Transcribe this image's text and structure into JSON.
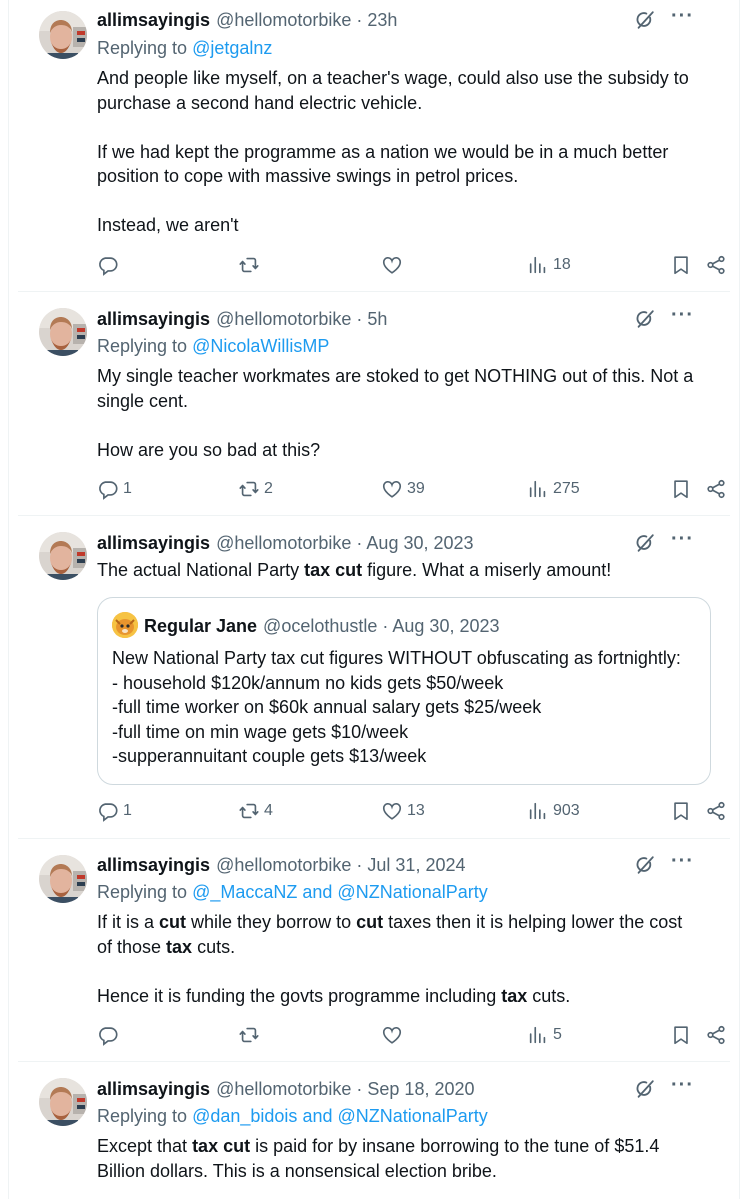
{
  "tweets": [
    {
      "author": "allimsayingis",
      "handle": "@hellomotorbike",
      "time": "23h",
      "reply_prefix": "Replying to",
      "reply_to": "@jetgalnz",
      "reply_and": "",
      "reply_to2": "",
      "paragraphs": [
        "And people like myself, on a teacher's wage, could also use the subsidy to purchase a second hand electric vehicle.",
        "If we had kept the programme as a nation we would be in a much better position to cope with massive swings in petrol prices.",
        "Instead, we aren't"
      ],
      "stats": {
        "replies": "",
        "reposts": "",
        "likes": "",
        "views": "18"
      }
    },
    {
      "author": "allimsayingis",
      "handle": "@hellomotorbike",
      "time": "5h",
      "reply_prefix": "Replying to",
      "reply_to": "@NicolaWillisMP",
      "reply_and": "",
      "reply_to2": "",
      "paragraphs": [
        "My single teacher workmates are stoked to get NOTHING out of this. Not a single cent.",
        "How are you so bad at this?"
      ],
      "stats": {
        "replies": "1",
        "reposts": "2",
        "likes": "39",
        "views": "275"
      }
    },
    {
      "author": "allimsayingis",
      "handle": "@hellomotorbike",
      "time": "Aug 30, 2023",
      "text_parts": [
        "The actual National Party ",
        "tax cut",
        " figure. What a miserly amount!"
      ],
      "quote": {
        "author": "Regular Jane",
        "handle": "@ocelothustle",
        "time": "Aug 30, 2023",
        "lines": [
          "New National Party tax cut figures WITHOUT obfuscating as fortnightly:",
          "- household $120k/annum no kids gets $50/week",
          "-full time worker on $60k annual salary gets $25/week",
          "-full time on min wage gets $10/week",
          "-supperannuitant couple gets $13/week"
        ]
      },
      "stats": {
        "replies": "1",
        "reposts": "4",
        "likes": "13",
        "views": "903"
      }
    },
    {
      "author": "allimsayingis",
      "handle": "@hellomotorbike",
      "time": "Jul 31, 2024",
      "reply_prefix": "Replying to",
      "reply_to": "@_MaccaNZ",
      "reply_and": " and ",
      "reply_to2": "@NZNationalParty",
      "p1_parts": [
        "If it is a ",
        "cut",
        " while they borrow to ",
        "cut",
        " taxes then it is helping lower the cost of those ",
        "tax",
        " cuts."
      ],
      "p2_parts": [
        "Hence it is funding the govts programme including ",
        "tax",
        " cuts."
      ],
      "stats": {
        "replies": "",
        "reposts": "",
        "likes": "",
        "views": "5"
      }
    },
    {
      "author": "allimsayingis",
      "handle": "@hellomotorbike",
      "time": "Sep 18, 2020",
      "reply_prefix": "Replying to",
      "reply_to": "@dan_bidois",
      "reply_and": " and ",
      "reply_to2": "@NZNationalParty",
      "text_parts": [
        "Except that ",
        "tax cut",
        " is paid for by insane borrowing to the tune of $51.4 Billion dollars. This is a nonsensical election bribe."
      ]
    }
  ],
  "icons": {
    "reply": "reply-icon",
    "repost": "repost-icon",
    "like": "like-icon",
    "views": "views-icon",
    "bookmark": "bookmark-icon",
    "share": "share-icon",
    "grok": "grok-icon",
    "more": "more-icon"
  },
  "colors": {
    "link": "#1d9bf0",
    "muted": "#536471",
    "text": "#0f1419",
    "border": "#eff3f4"
  }
}
